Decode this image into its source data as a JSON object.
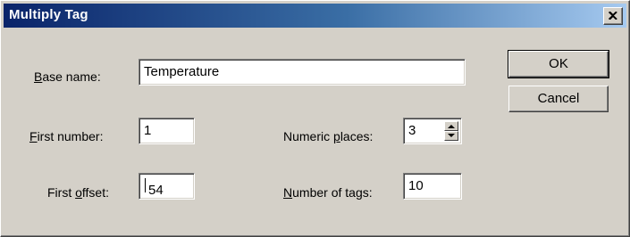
{
  "window": {
    "title": "Multiply Tag"
  },
  "fields": {
    "base_name": {
      "label_key": "B",
      "label_rest": "ase name:",
      "value": "Temperature"
    },
    "first_number": {
      "label_key": "F",
      "label_rest": "irst number:",
      "value": "1"
    },
    "first_offset": {
      "label_pre": "First ",
      "label_key": "o",
      "label_rest": "ffset:",
      "value": "54"
    },
    "numeric_places": {
      "label_pre": "Numeric ",
      "label_key": "p",
      "label_rest": "laces:",
      "value": "3"
    },
    "number_of_tags": {
      "label_key": "N",
      "label_rest": "umber of tags:",
      "value": "10"
    }
  },
  "buttons": {
    "ok": "OK",
    "cancel": "Cancel"
  }
}
